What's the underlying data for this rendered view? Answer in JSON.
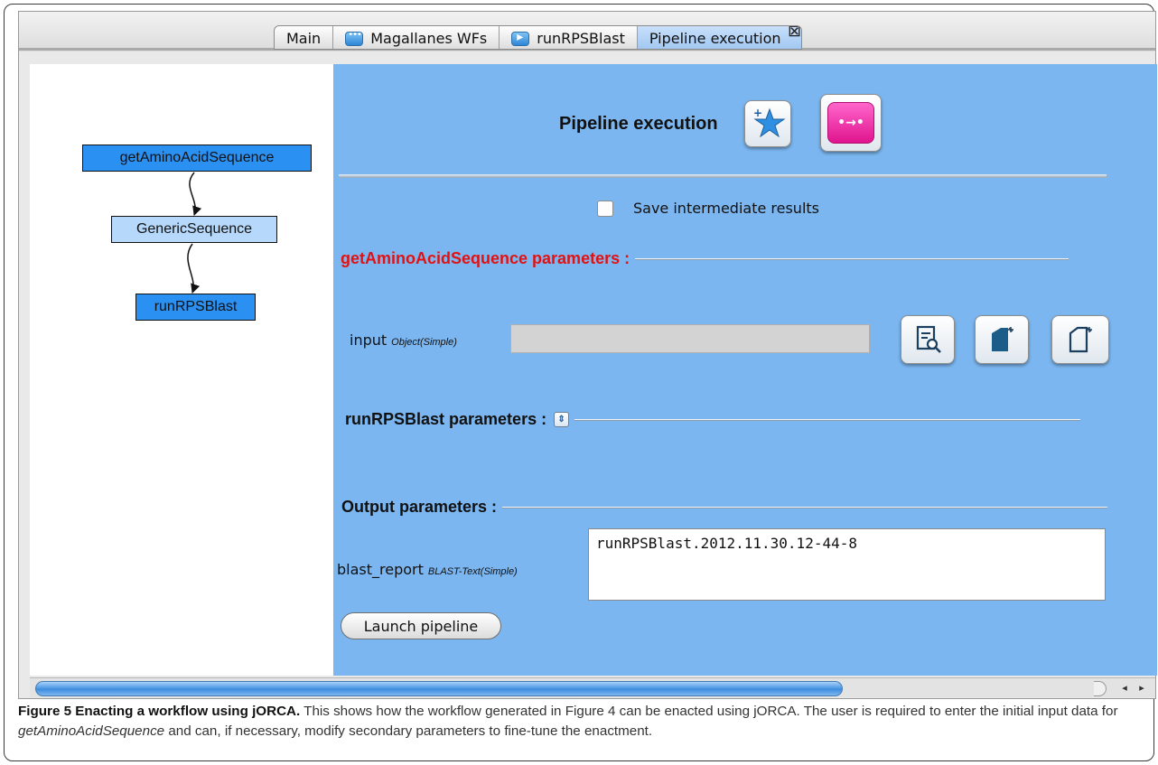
{
  "tabs": [
    {
      "label": "Main"
    },
    {
      "label": "Magallanes WFs",
      "icon": "workflow-icon"
    },
    {
      "label": "runRPSBlast",
      "icon": "service-icon"
    },
    {
      "label": "Pipeline execution",
      "active": true
    }
  ],
  "graph": {
    "nodes": [
      {
        "label": "getAminoAcidSequence"
      },
      {
        "label": "GenericSequence"
      },
      {
        "label": "runRPSBlast"
      }
    ]
  },
  "exec": {
    "title": "Pipeline execution",
    "save_label": "Save intermediate results",
    "sections": {
      "aa": "getAminoAcidSequence parameters :",
      "rps": "runRPSBlast parameters :",
      "out": "Output parameters :"
    },
    "input": {
      "label": "input",
      "type": "Object(Simple)",
      "value": ""
    },
    "output": {
      "label": "blast_report",
      "type": "BLAST-Text(Simple)",
      "value": "runRPSBlast.2012.11.30.12-44-8"
    },
    "launch_label": "Launch pipeline"
  },
  "colors": {
    "panel_bg": "#7bb6f0",
    "node_primary": "#2a90f2",
    "node_secondary": "#b6d8fa",
    "section_accent": "#e21212",
    "launch_icon": "#e0148e"
  },
  "caption": {
    "bold": "Figure 5 Enacting a workflow using jORCA.",
    "text1": " This shows how the workflow generated in Figure 4 can be enacted using jORCA. The user is required to enter the initial input data for ",
    "italic": "getAminoAcidSequence",
    "text2": " and can, if necessary, modify secondary parameters to fine-tune the enactment."
  }
}
